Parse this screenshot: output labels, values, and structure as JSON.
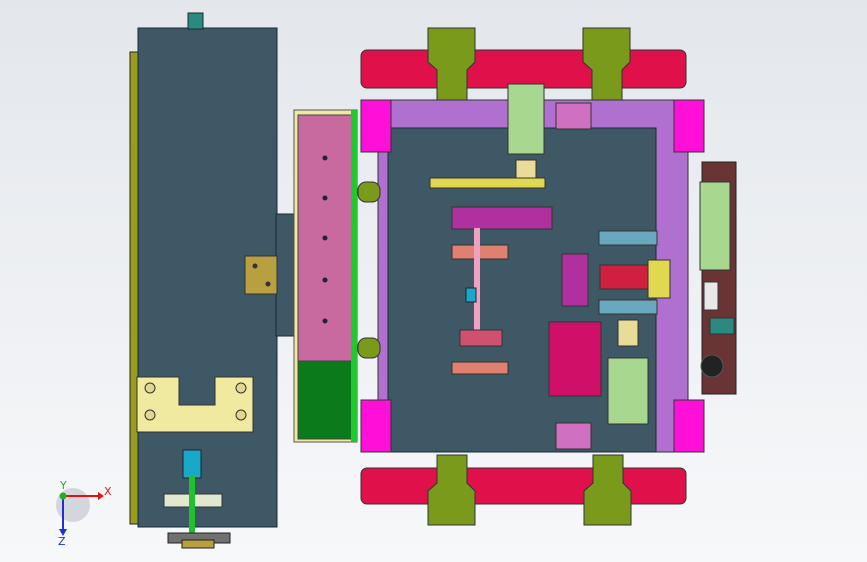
{
  "triad": {
    "x_label": "X",
    "y_label": "Y",
    "z_label": "Z",
    "x_color": "#e81010",
    "y_color": "#22b022",
    "z_color": "#2030d8"
  },
  "colors": {
    "steel_plate": "#3e5866",
    "olive": "#9a9c1e",
    "magenta": "#ff10d8",
    "red_belt": "#e0104a",
    "green_bracket": "#7a9a1c",
    "violet_frame": "#b070d0",
    "brass": "#b8a040",
    "pink_block": "#c86aa0",
    "green_block": "#0a7a1a",
    "gear_magenta": "#b030a0",
    "gear_red": "#d02040",
    "motor": "#a8d890",
    "shaft_cyan": "#18a8c8",
    "rust": "#6a3434",
    "cream": "#f0eaa0"
  }
}
